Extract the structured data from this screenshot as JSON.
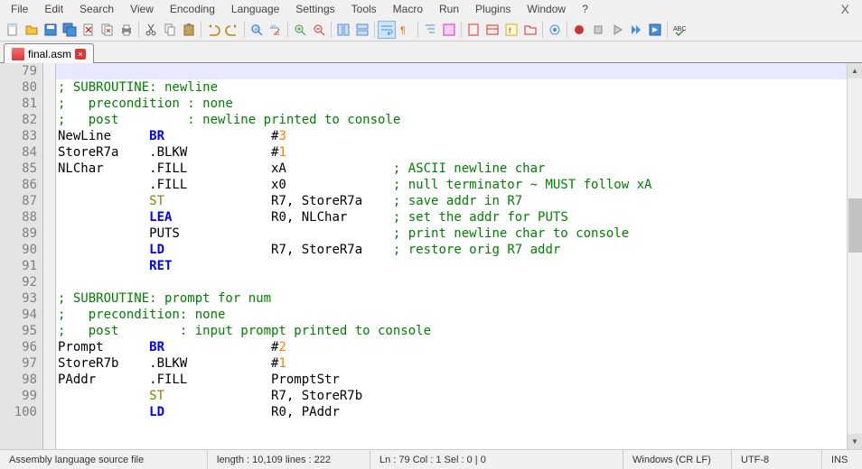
{
  "menu": {
    "items": [
      "File",
      "Edit",
      "Search",
      "View",
      "Encoding",
      "Language",
      "Settings",
      "Tools",
      "Macro",
      "Run",
      "Plugins",
      "Window",
      "?"
    ]
  },
  "tab": {
    "filename": "final.asm"
  },
  "gutter": {
    "start": 79,
    "end": 100
  },
  "code": {
    "lines": [
      {
        "n": 79,
        "segs": [
          {
            "t": "",
            "c": ""
          }
        ],
        "current": true
      },
      {
        "n": 80,
        "segs": [
          {
            "t": "; SUBROUTINE: newline",
            "c": "c-com"
          }
        ]
      },
      {
        "n": 81,
        "segs": [
          {
            "t": ";   precondition : none",
            "c": "c-com"
          }
        ]
      },
      {
        "n": 82,
        "segs": [
          {
            "t": ";   post         : newline printed to console",
            "c": "c-com"
          }
        ]
      },
      {
        "n": 83,
        "segs": [
          {
            "t": "NewLine     ",
            "c": ""
          },
          {
            "t": "BR",
            "c": "c-op"
          },
          {
            "t": "              #",
            "c": ""
          },
          {
            "t": "3",
            "c": "c-num"
          }
        ]
      },
      {
        "n": 84,
        "segs": [
          {
            "t": "StoreR7a    .BLKW           #",
            "c": ""
          },
          {
            "t": "1",
            "c": "c-num"
          }
        ]
      },
      {
        "n": 85,
        "segs": [
          {
            "t": "NLChar      .FILL           xA              ",
            "c": ""
          },
          {
            "t": "; ASCII newline char",
            "c": "c-com"
          }
        ]
      },
      {
        "n": 86,
        "segs": [
          {
            "t": "            .FILL           x0              ",
            "c": ""
          },
          {
            "t": "; null terminator ~ MUST follow xA",
            "c": "c-com"
          }
        ]
      },
      {
        "n": 87,
        "segs": [
          {
            "t": "            ",
            "c": ""
          },
          {
            "t": "ST",
            "c": "c-op2"
          },
          {
            "t": "              R7, StoreR7a    ",
            "c": ""
          },
          {
            "t": "; save addr in R7",
            "c": "c-com"
          }
        ]
      },
      {
        "n": 88,
        "segs": [
          {
            "t": "            ",
            "c": ""
          },
          {
            "t": "LEA",
            "c": "c-op"
          },
          {
            "t": "             R0, NLChar      ",
            "c": ""
          },
          {
            "t": "; set the addr for PUTS",
            "c": "c-com"
          }
        ]
      },
      {
        "n": 89,
        "segs": [
          {
            "t": "            PUTS                            ",
            "c": ""
          },
          {
            "t": "; print newline char to console",
            "c": "c-com"
          }
        ]
      },
      {
        "n": 90,
        "segs": [
          {
            "t": "            ",
            "c": ""
          },
          {
            "t": "LD",
            "c": "c-op"
          },
          {
            "t": "              R7, StoreR7a    ",
            "c": ""
          },
          {
            "t": "; restore orig R7 addr",
            "c": "c-com"
          }
        ]
      },
      {
        "n": 91,
        "segs": [
          {
            "t": "            ",
            "c": ""
          },
          {
            "t": "RET",
            "c": "c-op"
          }
        ]
      },
      {
        "n": 92,
        "segs": [
          {
            "t": "",
            "c": ""
          }
        ]
      },
      {
        "n": 93,
        "segs": [
          {
            "t": "; SUBROUTINE: prompt for num",
            "c": "c-com"
          }
        ]
      },
      {
        "n": 94,
        "segs": [
          {
            "t": ";   precondition: none",
            "c": "c-com"
          }
        ]
      },
      {
        "n": 95,
        "segs": [
          {
            "t": ";   post        : input prompt printed to console",
            "c": "c-com"
          }
        ]
      },
      {
        "n": 96,
        "segs": [
          {
            "t": "Prompt      ",
            "c": ""
          },
          {
            "t": "BR",
            "c": "c-op"
          },
          {
            "t": "              #",
            "c": ""
          },
          {
            "t": "2",
            "c": "c-num"
          }
        ]
      },
      {
        "n": 97,
        "segs": [
          {
            "t": "StoreR7b    .BLKW           #",
            "c": ""
          },
          {
            "t": "1",
            "c": "c-num"
          }
        ]
      },
      {
        "n": 98,
        "segs": [
          {
            "t": "PAddr       .FILL           PromptStr",
            "c": ""
          }
        ]
      },
      {
        "n": 99,
        "segs": [
          {
            "t": "            ",
            "c": ""
          },
          {
            "t": "ST",
            "c": "c-op2"
          },
          {
            "t": "              R7, StoreR7b",
            "c": ""
          }
        ]
      },
      {
        "n": 100,
        "segs": [
          {
            "t": "            ",
            "c": ""
          },
          {
            "t": "LD",
            "c": "c-op"
          },
          {
            "t": "              R0, PAddr",
            "c": ""
          }
        ]
      }
    ]
  },
  "status": {
    "lang": "Assembly language source file",
    "length": "length : 10,109    lines : 222",
    "pos": "Ln : 79    Col : 1    Sel : 0 | 0",
    "eol": "Windows (CR LF)",
    "enc": "UTF-8",
    "ins": "INS"
  },
  "toolbar_icons": [
    "new",
    "open",
    "save",
    "save-all",
    "close",
    "close-all",
    "print",
    "",
    "cut",
    "copy",
    "paste",
    "",
    "undo",
    "redo",
    "",
    "find",
    "replace",
    "",
    "zoom-in",
    "zoom-out",
    "",
    "sync-v",
    "sync-h",
    "",
    "wrap",
    "all-chars",
    "",
    "indent",
    "outdent",
    "",
    "fold",
    "unfold",
    "",
    "hidden",
    "dir",
    "",
    "record",
    "stop",
    "play",
    "play-multi",
    "save-macro",
    "",
    "spell"
  ]
}
